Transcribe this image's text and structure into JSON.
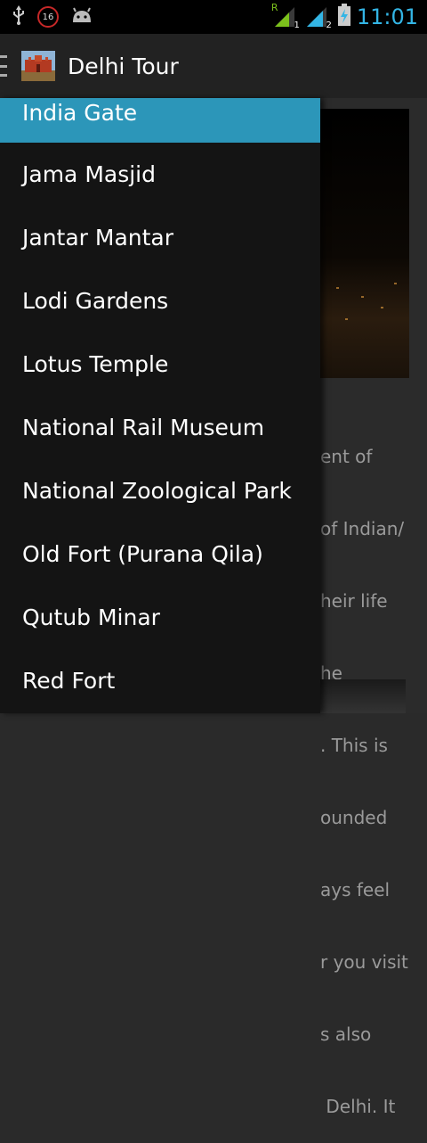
{
  "status_bar": {
    "notification_badge": "16",
    "signal_1_label": "1",
    "signal_2_label": "2",
    "roaming_label": "R",
    "time": "11:01"
  },
  "action_bar": {
    "title": "Delhi Tour"
  },
  "drawer": {
    "items": [
      {
        "label": "India Gate",
        "selected": true
      },
      {
        "label": "Jama Masjid"
      },
      {
        "label": "Jantar Mantar"
      },
      {
        "label": "Lodi Gardens"
      },
      {
        "label": "Lotus Temple"
      },
      {
        "label": "National Rail Museum"
      },
      {
        "label": "National Zoological Park"
      },
      {
        "label": "Old Fort (Purana Qila)"
      },
      {
        "label": "Qutub Minar"
      },
      {
        "label": "Red Fort"
      }
    ]
  },
  "background_text": {
    "lines": [
      "ent of",
      "of Indian/",
      "heir life",
      "he",
      ". This is",
      "ounded",
      "ays feel",
      "r you visit",
      "s also",
      " Delhi. It"
    ]
  },
  "colors": {
    "accent": "#33b5e5",
    "selected_item": "#2c96b9"
  }
}
